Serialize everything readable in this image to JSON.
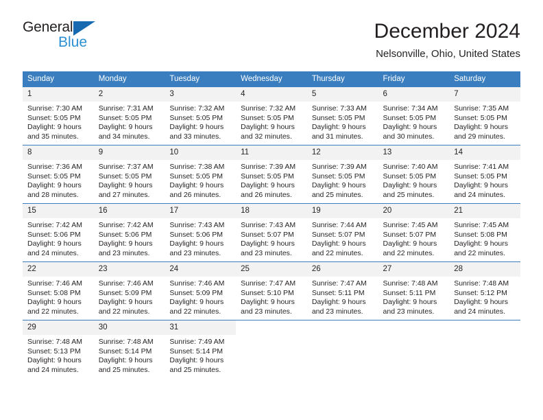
{
  "brand": {
    "name_top": "General",
    "name_bottom": "Blue",
    "triangle_color": "#1769b0",
    "blue_text_color": "#2a8fd4"
  },
  "header": {
    "title": "December 2024",
    "location": "Nelsonville, Ohio, United States"
  },
  "theme": {
    "header_blue": "#3a7ebf",
    "daynum_band": "#f2f2f2",
    "text": "#231f20"
  },
  "weekdays": [
    "Sunday",
    "Monday",
    "Tuesday",
    "Wednesday",
    "Thursday",
    "Friday",
    "Saturday"
  ],
  "weeks": [
    [
      {
        "day": "1",
        "sunrise": "Sunrise: 7:30 AM",
        "sunset": "Sunset: 5:05 PM",
        "daylight_line1": "Daylight: 9 hours",
        "daylight_line2": "and 35 minutes."
      },
      {
        "day": "2",
        "sunrise": "Sunrise: 7:31 AM",
        "sunset": "Sunset: 5:05 PM",
        "daylight_line1": "Daylight: 9 hours",
        "daylight_line2": "and 34 minutes."
      },
      {
        "day": "3",
        "sunrise": "Sunrise: 7:32 AM",
        "sunset": "Sunset: 5:05 PM",
        "daylight_line1": "Daylight: 9 hours",
        "daylight_line2": "and 33 minutes."
      },
      {
        "day": "4",
        "sunrise": "Sunrise: 7:32 AM",
        "sunset": "Sunset: 5:05 PM",
        "daylight_line1": "Daylight: 9 hours",
        "daylight_line2": "and 32 minutes."
      },
      {
        "day": "5",
        "sunrise": "Sunrise: 7:33 AM",
        "sunset": "Sunset: 5:05 PM",
        "daylight_line1": "Daylight: 9 hours",
        "daylight_line2": "and 31 minutes."
      },
      {
        "day": "6",
        "sunrise": "Sunrise: 7:34 AM",
        "sunset": "Sunset: 5:05 PM",
        "daylight_line1": "Daylight: 9 hours",
        "daylight_line2": "and 30 minutes."
      },
      {
        "day": "7",
        "sunrise": "Sunrise: 7:35 AM",
        "sunset": "Sunset: 5:05 PM",
        "daylight_line1": "Daylight: 9 hours",
        "daylight_line2": "and 29 minutes."
      }
    ],
    [
      {
        "day": "8",
        "sunrise": "Sunrise: 7:36 AM",
        "sunset": "Sunset: 5:05 PM",
        "daylight_line1": "Daylight: 9 hours",
        "daylight_line2": "and 28 minutes."
      },
      {
        "day": "9",
        "sunrise": "Sunrise: 7:37 AM",
        "sunset": "Sunset: 5:05 PM",
        "daylight_line1": "Daylight: 9 hours",
        "daylight_line2": "and 27 minutes."
      },
      {
        "day": "10",
        "sunrise": "Sunrise: 7:38 AM",
        "sunset": "Sunset: 5:05 PM",
        "daylight_line1": "Daylight: 9 hours",
        "daylight_line2": "and 26 minutes."
      },
      {
        "day": "11",
        "sunrise": "Sunrise: 7:39 AM",
        "sunset": "Sunset: 5:05 PM",
        "daylight_line1": "Daylight: 9 hours",
        "daylight_line2": "and 26 minutes."
      },
      {
        "day": "12",
        "sunrise": "Sunrise: 7:39 AM",
        "sunset": "Sunset: 5:05 PM",
        "daylight_line1": "Daylight: 9 hours",
        "daylight_line2": "and 25 minutes."
      },
      {
        "day": "13",
        "sunrise": "Sunrise: 7:40 AM",
        "sunset": "Sunset: 5:05 PM",
        "daylight_line1": "Daylight: 9 hours",
        "daylight_line2": "and 25 minutes."
      },
      {
        "day": "14",
        "sunrise": "Sunrise: 7:41 AM",
        "sunset": "Sunset: 5:05 PM",
        "daylight_line1": "Daylight: 9 hours",
        "daylight_line2": "and 24 minutes."
      }
    ],
    [
      {
        "day": "15",
        "sunrise": "Sunrise: 7:42 AM",
        "sunset": "Sunset: 5:06 PM",
        "daylight_line1": "Daylight: 9 hours",
        "daylight_line2": "and 24 minutes."
      },
      {
        "day": "16",
        "sunrise": "Sunrise: 7:42 AM",
        "sunset": "Sunset: 5:06 PM",
        "daylight_line1": "Daylight: 9 hours",
        "daylight_line2": "and 23 minutes."
      },
      {
        "day": "17",
        "sunrise": "Sunrise: 7:43 AM",
        "sunset": "Sunset: 5:06 PM",
        "daylight_line1": "Daylight: 9 hours",
        "daylight_line2": "and 23 minutes."
      },
      {
        "day": "18",
        "sunrise": "Sunrise: 7:43 AM",
        "sunset": "Sunset: 5:07 PM",
        "daylight_line1": "Daylight: 9 hours",
        "daylight_line2": "and 23 minutes."
      },
      {
        "day": "19",
        "sunrise": "Sunrise: 7:44 AM",
        "sunset": "Sunset: 5:07 PM",
        "daylight_line1": "Daylight: 9 hours",
        "daylight_line2": "and 22 minutes."
      },
      {
        "day": "20",
        "sunrise": "Sunrise: 7:45 AM",
        "sunset": "Sunset: 5:07 PM",
        "daylight_line1": "Daylight: 9 hours",
        "daylight_line2": "and 22 minutes."
      },
      {
        "day": "21",
        "sunrise": "Sunrise: 7:45 AM",
        "sunset": "Sunset: 5:08 PM",
        "daylight_line1": "Daylight: 9 hours",
        "daylight_line2": "and 22 minutes."
      }
    ],
    [
      {
        "day": "22",
        "sunrise": "Sunrise: 7:46 AM",
        "sunset": "Sunset: 5:08 PM",
        "daylight_line1": "Daylight: 9 hours",
        "daylight_line2": "and 22 minutes."
      },
      {
        "day": "23",
        "sunrise": "Sunrise: 7:46 AM",
        "sunset": "Sunset: 5:09 PM",
        "daylight_line1": "Daylight: 9 hours",
        "daylight_line2": "and 22 minutes."
      },
      {
        "day": "24",
        "sunrise": "Sunrise: 7:46 AM",
        "sunset": "Sunset: 5:09 PM",
        "daylight_line1": "Daylight: 9 hours",
        "daylight_line2": "and 22 minutes."
      },
      {
        "day": "25",
        "sunrise": "Sunrise: 7:47 AM",
        "sunset": "Sunset: 5:10 PM",
        "daylight_line1": "Daylight: 9 hours",
        "daylight_line2": "and 23 minutes."
      },
      {
        "day": "26",
        "sunrise": "Sunrise: 7:47 AM",
        "sunset": "Sunset: 5:11 PM",
        "daylight_line1": "Daylight: 9 hours",
        "daylight_line2": "and 23 minutes."
      },
      {
        "day": "27",
        "sunrise": "Sunrise: 7:48 AM",
        "sunset": "Sunset: 5:11 PM",
        "daylight_line1": "Daylight: 9 hours",
        "daylight_line2": "and 23 minutes."
      },
      {
        "day": "28",
        "sunrise": "Sunrise: 7:48 AM",
        "sunset": "Sunset: 5:12 PM",
        "daylight_line1": "Daylight: 9 hours",
        "daylight_line2": "and 24 minutes."
      }
    ],
    [
      {
        "day": "29",
        "sunrise": "Sunrise: 7:48 AM",
        "sunset": "Sunset: 5:13 PM",
        "daylight_line1": "Daylight: 9 hours",
        "daylight_line2": "and 24 minutes."
      },
      {
        "day": "30",
        "sunrise": "Sunrise: 7:48 AM",
        "sunset": "Sunset: 5:14 PM",
        "daylight_line1": "Daylight: 9 hours",
        "daylight_line2": "and 25 minutes."
      },
      {
        "day": "31",
        "sunrise": "Sunrise: 7:49 AM",
        "sunset": "Sunset: 5:14 PM",
        "daylight_line1": "Daylight: 9 hours",
        "daylight_line2": "and 25 minutes."
      },
      {
        "day": "",
        "sunrise": "",
        "sunset": "",
        "daylight_line1": "",
        "daylight_line2": ""
      },
      {
        "day": "",
        "sunrise": "",
        "sunset": "",
        "daylight_line1": "",
        "daylight_line2": ""
      },
      {
        "day": "",
        "sunrise": "",
        "sunset": "",
        "daylight_line1": "",
        "daylight_line2": ""
      },
      {
        "day": "",
        "sunrise": "",
        "sunset": "",
        "daylight_line1": "",
        "daylight_line2": ""
      }
    ]
  ]
}
